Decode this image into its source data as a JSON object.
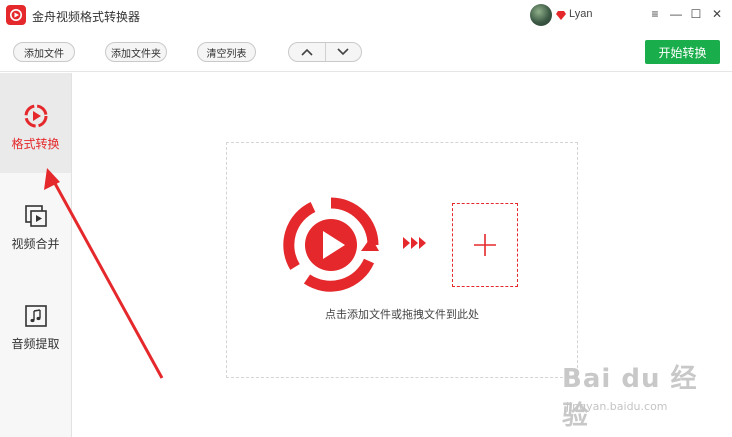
{
  "app": {
    "title": "金舟视频格式转换器",
    "accent_color": "#e5282b",
    "green_color": "#1aad4b"
  },
  "titlebar": {
    "username": "Lyan",
    "avatar_icon": "user-avatar",
    "vip_icon": "diamond-icon",
    "menu_icon": "≡",
    "minimize_icon": "—",
    "maximize_icon": "☐",
    "close_icon": "✕"
  },
  "toolbar": {
    "add_file": "添加文件",
    "add_folder": "添加文件夹",
    "clear_list": "清空列表",
    "move_up_icon": "chevron-up-icon",
    "move_down_icon": "chevron-down-icon",
    "start": "开始转换"
  },
  "sidebar": {
    "items": [
      {
        "label": "格式转换",
        "icon": "format-convert-icon",
        "active": true
      },
      {
        "label": "视频合并",
        "icon": "video-merge-icon",
        "active": false
      },
      {
        "label": "音频提取",
        "icon": "audio-extract-icon",
        "active": false
      }
    ]
  },
  "main": {
    "hint": "点击添加文件或拖拽文件到此处",
    "add_icon": "plus-icon"
  },
  "watermark": {
    "main": "Bai du 经验",
    "sub": "jingyan.baidu.com"
  }
}
